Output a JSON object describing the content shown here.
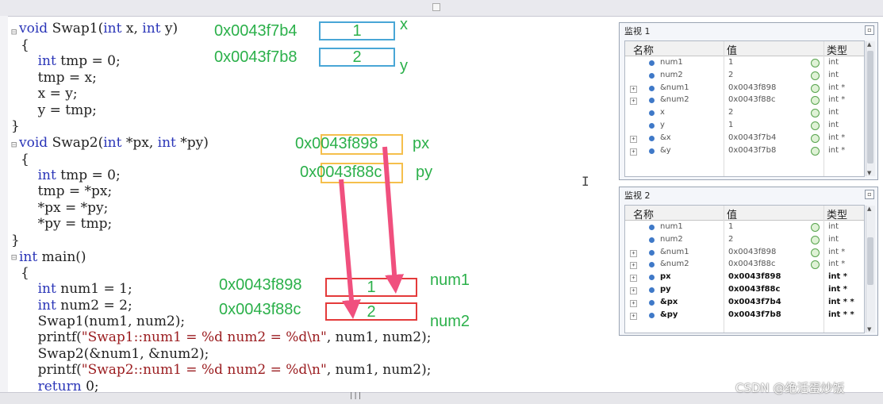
{
  "code": {
    "lines": [
      [
        "void",
        " Swap1(",
        "int",
        " x, ",
        "int",
        " y)"
      ],
      [
        "{"
      ],
      [
        "    ",
        "int",
        " tmp = 0;"
      ],
      [
        "    tmp = x;"
      ],
      [
        "    x = y;"
      ],
      [
        "    y = tmp;"
      ],
      [
        "}"
      ],
      [
        "void",
        " Swap2(",
        "int",
        " *px, ",
        "int",
        " *py)"
      ],
      [
        "{"
      ],
      [
        "    ",
        "int",
        " tmp = 0;"
      ],
      [
        "    tmp = *px;"
      ],
      [
        "    *px = *py;"
      ],
      [
        "    *py = tmp;"
      ],
      [
        "}"
      ],
      [
        "int",
        " main()"
      ],
      [
        "{"
      ],
      [
        "    ",
        "int",
        " num1 = 1;"
      ],
      [
        "    ",
        "int",
        " num2 = 2;"
      ],
      [
        "    Swap1(num1, num2);"
      ],
      [
        "    printf(",
        "\"Swap1::num1 = %d num2 = %d\\n\"",
        ", num1, num2);"
      ],
      [
        "    Swap2(&num1, &num2);"
      ],
      [
        "    printf(",
        "\"Swap2::num1 = %d num2 = %d\\n\"",
        ", num1, num2);"
      ],
      [
        "    ",
        "return",
        " 0;"
      ]
    ],
    "keywords": [
      "void",
      "int",
      "return"
    ]
  },
  "annotations": {
    "x_addr": "0x0043f7b4",
    "x_value": "1",
    "x_label": "x",
    "y_addr": "0x0043f7b8",
    "y_value": "2",
    "y_label": "y",
    "px_value": "0x0043f898",
    "px_label": "px",
    "py_value": "0x0043f88c",
    "py_label": "py",
    "num1_addr": "0x0043f898",
    "num1_value": "1",
    "num1_label": "num1",
    "num2_addr": "0x0043f88c",
    "num2_value": "2",
    "num2_label": "num2"
  },
  "colors": {
    "annotation_green": "#2bb04a",
    "arrow_pink": "#f0507e",
    "box_blue": "#49a6d6",
    "box_orange": "#f5bf4c",
    "box_red": "#e43a3a"
  },
  "watch1": {
    "title": "监视 1",
    "columns": [
      "名称",
      "值",
      "类型"
    ],
    "rows": [
      {
        "expand": false,
        "name": "num1",
        "value": "1",
        "type": "int",
        "bold": false
      },
      {
        "expand": false,
        "name": "num2",
        "value": "2",
        "type": "int",
        "bold": false
      },
      {
        "expand": true,
        "name": "&num1",
        "value": "0x0043f898",
        "type": "int *",
        "bold": false
      },
      {
        "expand": true,
        "name": "&num2",
        "value": "0x0043f88c",
        "type": "int *",
        "bold": false
      },
      {
        "expand": false,
        "name": "x",
        "value": "2",
        "type": "int",
        "bold": false
      },
      {
        "expand": false,
        "name": "y",
        "value": "1",
        "type": "int",
        "bold": false
      },
      {
        "expand": true,
        "name": "&x",
        "value": "0x0043f7b4",
        "type": "int *",
        "bold": false
      },
      {
        "expand": true,
        "name": "&y",
        "value": "0x0043f7b8",
        "type": "int *",
        "bold": false
      }
    ]
  },
  "watch2": {
    "title": "监视 2",
    "columns": [
      "名称",
      "值",
      "类型"
    ],
    "rows": [
      {
        "expand": false,
        "name": "num1",
        "value": "1",
        "type": "int",
        "bold": false
      },
      {
        "expand": false,
        "name": "num2",
        "value": "2",
        "type": "int",
        "bold": false
      },
      {
        "expand": true,
        "name": "&num1",
        "value": "0x0043f898",
        "type": "int *",
        "bold": false
      },
      {
        "expand": true,
        "name": "&num2",
        "value": "0x0043f88c",
        "type": "int *",
        "bold": false
      },
      {
        "expand": true,
        "name": "px",
        "value": "0x0043f898",
        "type": "int *",
        "bold": true
      },
      {
        "expand": true,
        "name": "py",
        "value": "0x0043f88c",
        "type": "int *",
        "bold": true
      },
      {
        "expand": true,
        "name": "&px",
        "value": "0x0043f7b4",
        "type": "int * *",
        "bold": true
      },
      {
        "expand": true,
        "name": "&py",
        "value": "0x0043f7b8",
        "type": "int * *",
        "bold": true
      }
    ]
  },
  "watermark": "CSDN @绝活蛋炒饭"
}
